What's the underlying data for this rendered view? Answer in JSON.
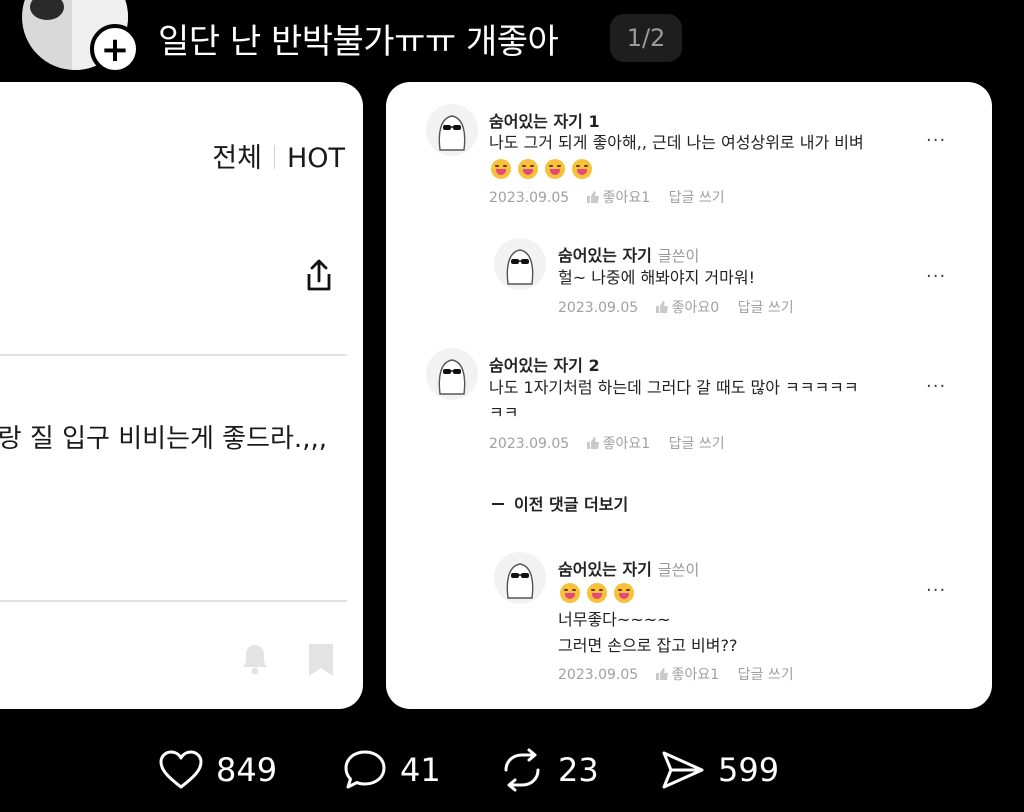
{
  "header": {
    "title": "일단 난 반박불가ㅠㅠ 개좋아",
    "pager": "1/2",
    "follow_symbol": "+"
  },
  "left_card": {
    "tabs": [
      "전체",
      "HOT"
    ],
    "post_text": "랑 질 입구 비비는게 좋드라.,,,"
  },
  "comments": [
    {
      "name": "숨어있는 자기 1",
      "text_lines": [
        "나도 그거 되게 좋아해,, 근데 나는 여성상위로 내가 비벼"
      ],
      "emoji_count": 4,
      "date": "2023.09.05",
      "like_label": "좋아요1",
      "reply_label": "답글 쓰기",
      "more": "···"
    },
    {
      "name": "숨어있는 자기",
      "author_badge": "글쓴이",
      "text_lines": [
        "헐~ 나중에 해봐야지 거마워!"
      ],
      "date": "2023.09.05",
      "like_label": "좋아요0",
      "reply_label": "답글 쓰기",
      "more": "···"
    },
    {
      "name": "숨어있는 자기 2",
      "text_lines": [
        "나도 1자기처럼 하는데 그러다 갈 때도 많아 ㅋㅋㅋㅋㅋ",
        "ㅋㅋ"
      ],
      "date": "2023.09.05",
      "like_label": "좋아요1",
      "reply_label": "답글 쓰기",
      "more": "···"
    },
    {
      "name": "숨어있는 자기",
      "author_badge": "글쓴이",
      "emoji_count": 3,
      "text_lines": [
        "너무좋다~~~~",
        "그러면 손으로 잡고 비벼??"
      ],
      "date": "2023.09.05",
      "like_label": "좋아요1",
      "reply_label": "답글 쓰기",
      "more": "···"
    }
  ],
  "prev_comments_label": "이전 댓글 더보기",
  "actions": {
    "likes": "849",
    "comments": "41",
    "reposts": "23",
    "shares": "599"
  },
  "icons": {
    "share": "share-icon",
    "bell": "bell-icon",
    "bookmark": "bookmark-icon",
    "heart": "heart-icon",
    "comment": "comment-icon",
    "repost": "repost-icon",
    "send": "send-icon"
  },
  "colors": {
    "background": "#000000",
    "card": "#ffffff",
    "meta_gray": "#a0a0a0"
  }
}
